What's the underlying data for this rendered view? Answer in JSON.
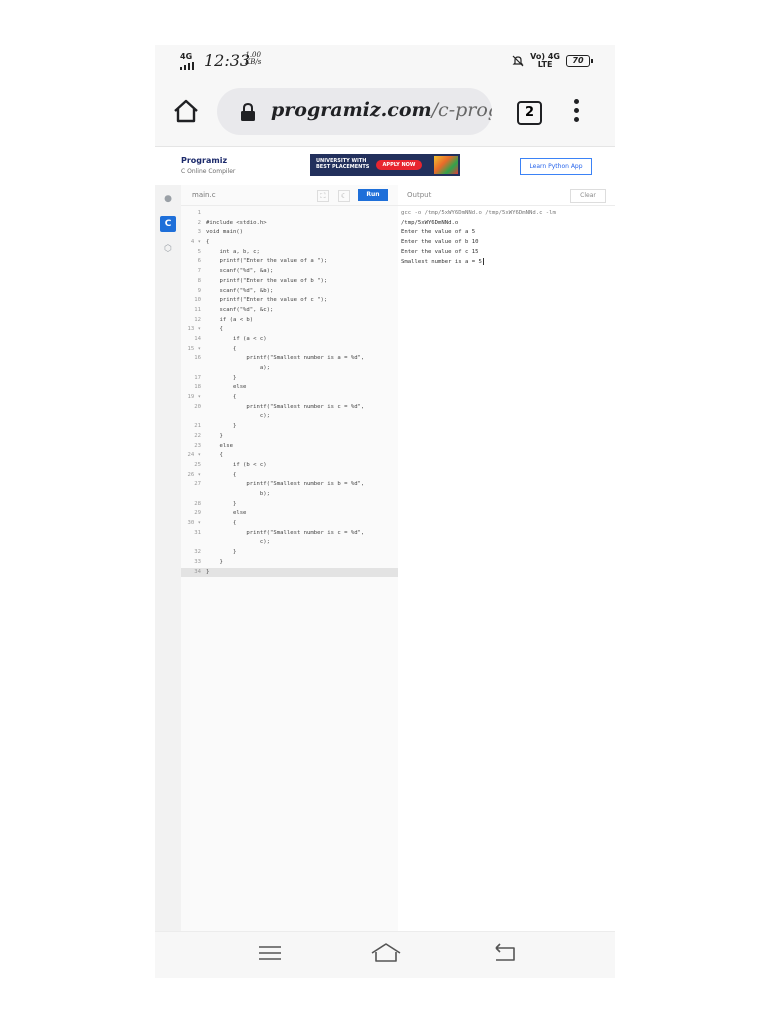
{
  "status_bar": {
    "network": "4G",
    "time": "12:33",
    "speed_value": "1.00",
    "speed_unit": "KB/s",
    "right_network_top": "Vo) 4G",
    "right_network_bottom": "LTE",
    "battery": "70"
  },
  "browser": {
    "url_domain": "programiz.com",
    "url_path": "/c-progr",
    "tab_count": "2"
  },
  "site": {
    "logo": "Programiz",
    "logo_sub": "C Online Compiler",
    "ad_text": "UNIVERSITY WITH BEST PLACEMENTS",
    "ad_button": "APPLY NOW",
    "learn_button": "Learn Python App"
  },
  "editor": {
    "file_name": "main.c",
    "run_label": "Run",
    "lines": [
      {
        "n": "1",
        "t": ""
      },
      {
        "n": "2",
        "t": "#include <stdio.h>"
      },
      {
        "n": "3",
        "t": "void main()"
      },
      {
        "n": "4 ▾",
        "t": "{"
      },
      {
        "n": "5",
        "t": "    int a, b, c;"
      },
      {
        "n": "6",
        "t": "    printf(\"Enter the value of a \");"
      },
      {
        "n": "7",
        "t": "    scanf(\"%d\", &a);"
      },
      {
        "n": "8",
        "t": "    printf(\"Enter the value of b \");"
      },
      {
        "n": "9",
        "t": "    scanf(\"%d\", &b);"
      },
      {
        "n": "10",
        "t": "    printf(\"Enter the value of c \");"
      },
      {
        "n": "11",
        "t": "    scanf(\"%d\", &c);"
      },
      {
        "n": "12",
        "t": "    if (a < b)"
      },
      {
        "n": "13 ▾",
        "t": "    {"
      },
      {
        "n": "14",
        "t": "        if (a < c)"
      },
      {
        "n": "15 ▾",
        "t": "        {"
      },
      {
        "n": "16",
        "t": "            printf(\"Smallest number is a = %d\",\n                a);"
      },
      {
        "n": "17",
        "t": "        }"
      },
      {
        "n": "18",
        "t": "        else"
      },
      {
        "n": "19 ▾",
        "t": "        {"
      },
      {
        "n": "20",
        "t": "            printf(\"Smallest number is c = %d\",\n                c);"
      },
      {
        "n": "21",
        "t": "        }"
      },
      {
        "n": "22",
        "t": "    }"
      },
      {
        "n": "23",
        "t": "    else"
      },
      {
        "n": "24 ▾",
        "t": "    {"
      },
      {
        "n": "25",
        "t": "        if (b < c)"
      },
      {
        "n": "26 ▾",
        "t": "        {"
      },
      {
        "n": "27",
        "t": "            printf(\"Smallest number is b = %d\",\n                b);"
      },
      {
        "n": "28",
        "t": "        }"
      },
      {
        "n": "29",
        "t": "        else"
      },
      {
        "n": "30 ▾",
        "t": "        {"
      },
      {
        "n": "31",
        "t": "            printf(\"Smallest number is c = %d\",\n                c);"
      },
      {
        "n": "32",
        "t": "        }"
      },
      {
        "n": "33",
        "t": "    }"
      },
      {
        "n": "34",
        "t": "}"
      }
    ]
  },
  "output": {
    "title": "Output",
    "clear_label": "Clear",
    "command": "gcc -o /tmp/5xWY6DmNNd.o /tmp/5xWY6DmNNd.c -lm",
    "lines": [
      "/tmp/5xWY6DmNNd.o",
      "Enter the value of a 5",
      "Enter the value of b 10",
      "Enter the value of c 15",
      "Smallest number is a = 5"
    ]
  }
}
